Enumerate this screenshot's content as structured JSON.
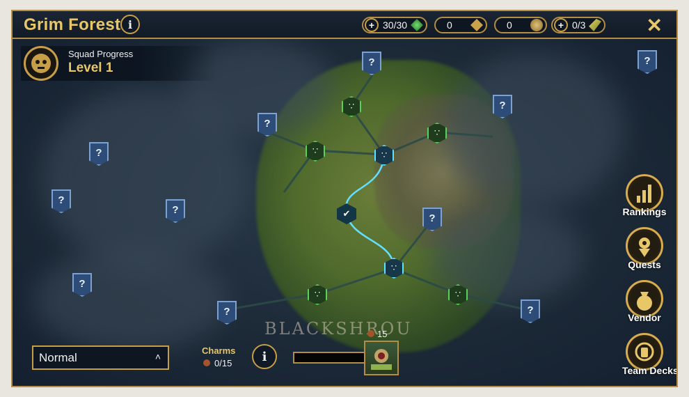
{
  "header": {
    "title": "Grim Forest",
    "info_glyph": "i",
    "energy": "30/30",
    "resource_a": "0",
    "resource_b": "0",
    "keys": "0/3",
    "close_glyph": "✕"
  },
  "squad": {
    "subtitle": "Squad Progress",
    "level": "Level 1"
  },
  "map": {
    "unknown_glyph": "?",
    "region_text": "BLACKSHROU"
  },
  "side_menu": [
    {
      "label": "Rankings",
      "icon": "rankings-icon"
    },
    {
      "label": "Quests",
      "icon": "quests-icon"
    },
    {
      "label": "Vendor",
      "icon": "vendor-icon"
    },
    {
      "label": "Team Decks",
      "icon": "team-decks-icon"
    }
  ],
  "footer": {
    "difficulty": "Normal",
    "charms_label": "Charms",
    "charms_count": "0/15",
    "info_glyph": "i",
    "reward_cost": "15"
  },
  "colors": {
    "gold": "#c79e48",
    "title_gold": "#e7c768",
    "node_green": "#5ad15a",
    "node_blue": "#61e0ff",
    "unknown_blue": "#2d4d78"
  }
}
